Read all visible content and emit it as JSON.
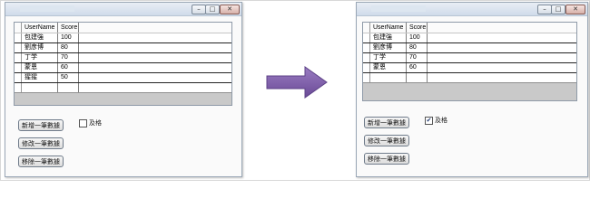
{
  "colors": {
    "arrow": "#7c5ba6",
    "window_border": "#9aa7b6",
    "grid_empty": "#c9c9c9"
  },
  "left_window": {
    "columns": [
      "UserName",
      "Score"
    ],
    "rows": [
      {
        "name": "包建強",
        "score": "100"
      },
      {
        "name": "劉彦博",
        "score": "80"
      },
      {
        "name": "丁学",
        "score": "70"
      },
      {
        "name": "蒙恩",
        "score": "60"
      },
      {
        "name": "猩猩",
        "score": "50"
      }
    ],
    "buttons": [
      "新增一筆數據",
      "修改一筆數據",
      "移除一筆數據"
    ],
    "checkbox": {
      "label": "及格",
      "checked": false
    }
  },
  "right_window": {
    "columns": [
      "UserName",
      "Score"
    ],
    "rows": [
      {
        "name": "包建強",
        "score": "100"
      },
      {
        "name": "劉彦博",
        "score": "80"
      },
      {
        "name": "丁学",
        "score": "70"
      },
      {
        "name": "蒙恩",
        "score": "60"
      }
    ],
    "buttons": [
      "新增一筆數據",
      "修改一筆數據",
      "移除一筆數據"
    ],
    "checkbox": {
      "label": "及格",
      "checked": true
    }
  },
  "icons": {
    "arrow": "right-arrow-icon",
    "check": "checkmark-icon"
  }
}
